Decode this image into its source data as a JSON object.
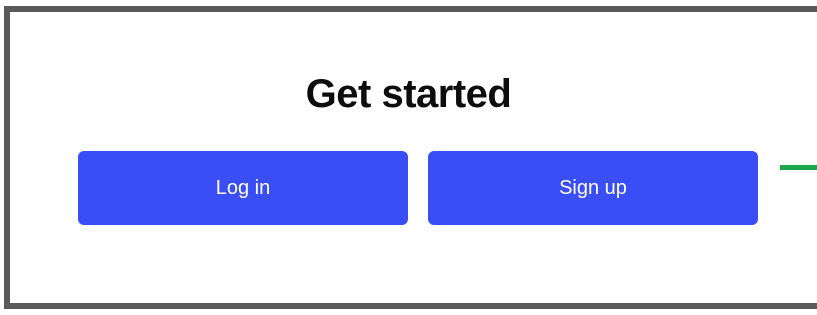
{
  "heading": "Get started",
  "buttons": {
    "login_label": "Log in",
    "signup_label": "Sign up"
  },
  "colors": {
    "button_bg": "#3a4ef6",
    "button_text": "#ffffff",
    "frame_border": "#5a5a5a",
    "annotation_line": "#1ea64a"
  }
}
